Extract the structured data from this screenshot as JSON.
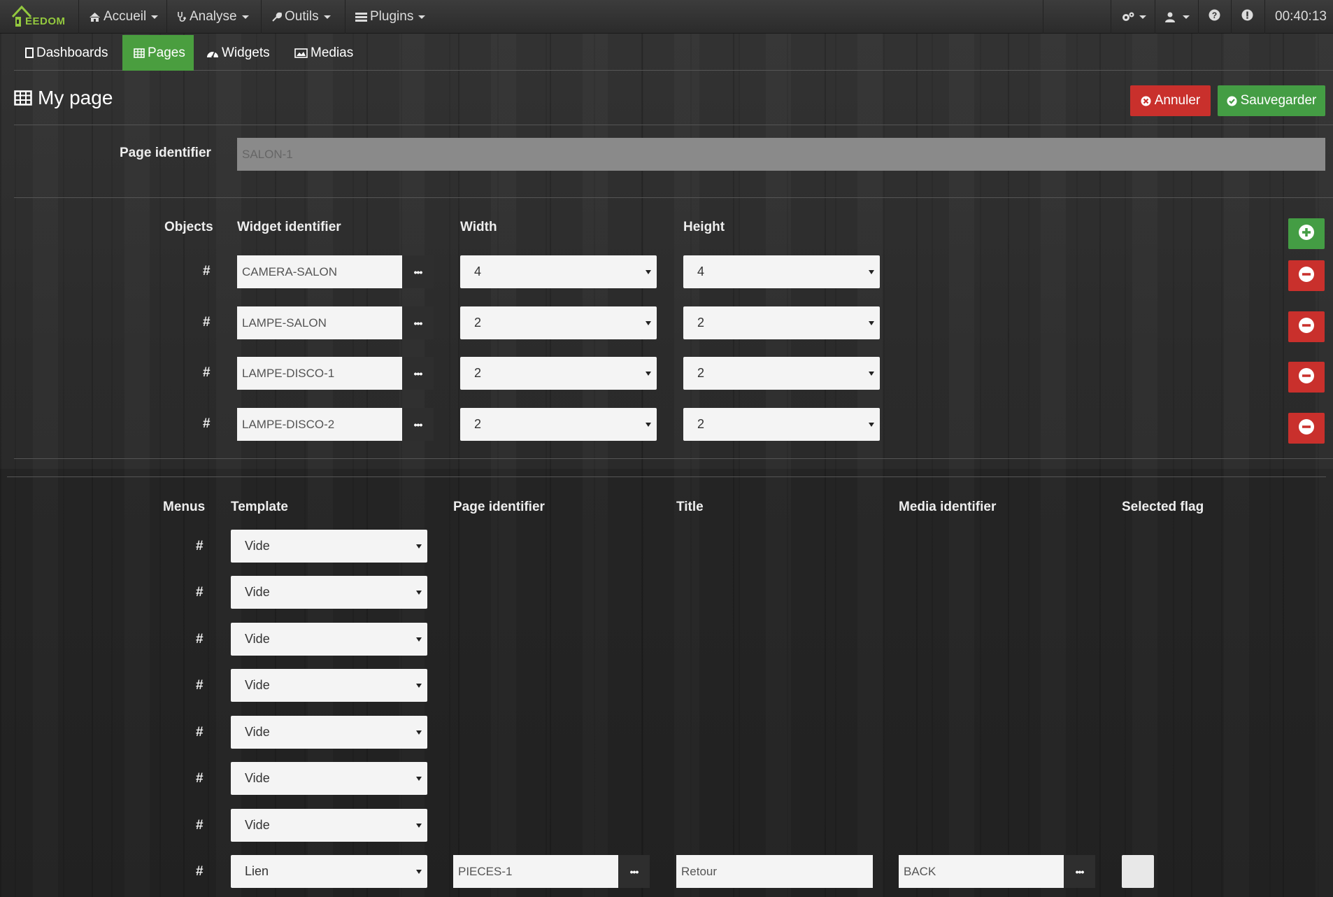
{
  "navbar": {
    "logo_text": "EEDOM",
    "items": [
      {
        "label": "Accueil",
        "icon": "home-icon"
      },
      {
        "label": "Analyse",
        "icon": "stethoscope-icon"
      },
      {
        "label": "Outils",
        "icon": "wrench-icon"
      },
      {
        "label": "Plugins",
        "icon": "tasks-icon"
      }
    ],
    "clock": "00:40:13"
  },
  "subnav": {
    "tabs": [
      {
        "label": "Dashboards",
        "icon": "square-icon",
        "active": false
      },
      {
        "label": "Pages",
        "icon": "table-icon",
        "active": true
      },
      {
        "label": "Widgets",
        "icon": "dashboard-icon",
        "active": false
      },
      {
        "label": "Medias",
        "icon": "picture-icon",
        "active": false
      }
    ]
  },
  "page": {
    "title": "My page",
    "cancel_label": "Annuler",
    "save_label": "Sauvegarder",
    "identifier_label": "Page identifier",
    "identifier_value": "SALON-1"
  },
  "objects": {
    "headers": {
      "objects": "Objects",
      "widget": "Widget identifier",
      "width": "Width",
      "height": "Height"
    },
    "rows": [
      {
        "hash": "#",
        "widget": "CAMERA-SALON",
        "width": "4",
        "height": "4"
      },
      {
        "hash": "#",
        "widget": "LAMPE-SALON",
        "width": "2",
        "height": "2"
      },
      {
        "hash": "#",
        "widget": "LAMPE-DISCO-1",
        "width": "2",
        "height": "2"
      },
      {
        "hash": "#",
        "widget": "LAMPE-DISCO-2",
        "width": "2",
        "height": "2"
      }
    ]
  },
  "menus": {
    "headers": {
      "menus": "Menus",
      "template": "Template",
      "page": "Page identifier",
      "title": "Title",
      "media": "Media identifier",
      "flag": "Selected flag"
    },
    "rows": [
      {
        "hash": "#",
        "template": "Vide"
      },
      {
        "hash": "#",
        "template": "Vide"
      },
      {
        "hash": "#",
        "template": "Vide"
      },
      {
        "hash": "#",
        "template": "Vide"
      },
      {
        "hash": "#",
        "template": "Vide"
      },
      {
        "hash": "#",
        "template": "Vide"
      },
      {
        "hash": "#",
        "template": "Vide"
      },
      {
        "hash": "#",
        "template": "Lien",
        "page": "PIECES-1",
        "title": "Retour",
        "media": "BACK",
        "selected": false
      }
    ]
  },
  "colors": {
    "accent_green": "#4a9e3f",
    "danger_red": "#c9302c",
    "logo_green": "#93c83e"
  }
}
